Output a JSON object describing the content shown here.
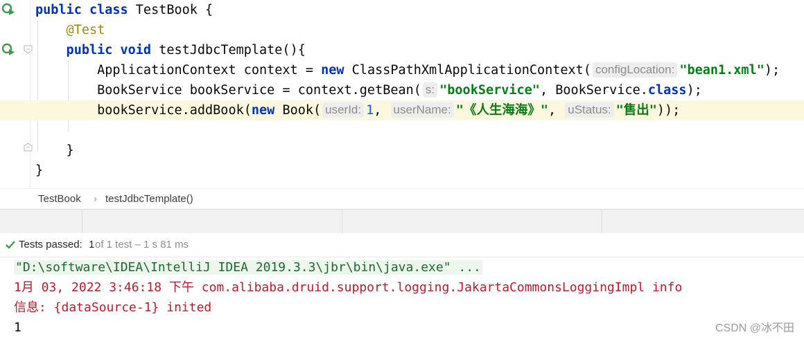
{
  "editor": {
    "lines": [
      {
        "parts": [
          {
            "t": "public class ",
            "c": "kw"
          },
          {
            "t": "TestBook {",
            "c": ""
          }
        ]
      },
      {
        "parts": [
          {
            "t": "    @Test",
            "c": "ann"
          }
        ]
      },
      {
        "parts": [
          {
            "t": "    public void ",
            "c": "kw"
          },
          {
            "t": "testJdbcTemplate(){",
            "c": ""
          }
        ]
      },
      {
        "parts": [
          {
            "t": "        ApplicationContext context = ",
            "c": ""
          },
          {
            "t": "new ",
            "c": "kw"
          },
          {
            "t": "ClassPathXmlApplicationContext(",
            "c": ""
          },
          {
            "t": "configLocation:",
            "c": "hint"
          },
          {
            "t": "\"bean1.xml\"",
            "c": "str"
          },
          {
            "t": ");",
            "c": ""
          }
        ]
      },
      {
        "parts": [
          {
            "t": "        BookService bookService = context.getBean(",
            "c": ""
          },
          {
            "t": "s:",
            "c": "hint"
          },
          {
            "t": "\"bookService\"",
            "c": "str"
          },
          {
            "t": ", BookService.",
            "c": ""
          },
          {
            "t": "class",
            "c": "kw"
          },
          {
            "t": ");",
            "c": ""
          }
        ]
      },
      {
        "parts": [
          {
            "t": "        bookService.addBook(",
            "c": ""
          },
          {
            "t": "new ",
            "c": "kw"
          },
          {
            "t": "Book(",
            "c": ""
          },
          {
            "t": "userId:",
            "c": "hint"
          },
          {
            "t": "1",
            "c": "num"
          },
          {
            "t": ", ",
            "c": ""
          },
          {
            "t": "userName:",
            "c": "hint"
          },
          {
            "t": "\"《人生海海》\"",
            "c": "str"
          },
          {
            "t": ", ",
            "c": ""
          },
          {
            "t": "uStatus:",
            "c": "hint"
          },
          {
            "t": "\"售出\"",
            "c": "str"
          },
          {
            "t": "));",
            "c": ""
          }
        ]
      },
      {
        "parts": []
      },
      {
        "parts": [
          {
            "t": "    }",
            "c": ""
          }
        ]
      },
      {
        "parts": [
          {
            "t": "}",
            "c": ""
          }
        ]
      }
    ],
    "current_line": 5,
    "num_color": "#1750eb"
  },
  "breadcrumbs": {
    "class_name": "TestBook",
    "separator": "›",
    "method_name": "testJdbcTemplate()"
  },
  "test_status": {
    "check_icon": "check-icon",
    "label": "Tests passed: ",
    "passed": "1",
    "detail": " of 1 test – 1 s 81 ms"
  },
  "console": {
    "command": "\"D:\\software\\IDEA\\IntelliJ IDEA 2019.3.3\\jbr\\bin\\java.exe\" ...",
    "log_line": "1月 03, 2022 3:46:18 下午 com.alibaba.druid.support.logging.JakartaCommonsLoggingImpl info",
    "info_line": "信息: {dataSource-1} inited",
    "output": "1"
  },
  "watermark": "CSDN @冰不田"
}
